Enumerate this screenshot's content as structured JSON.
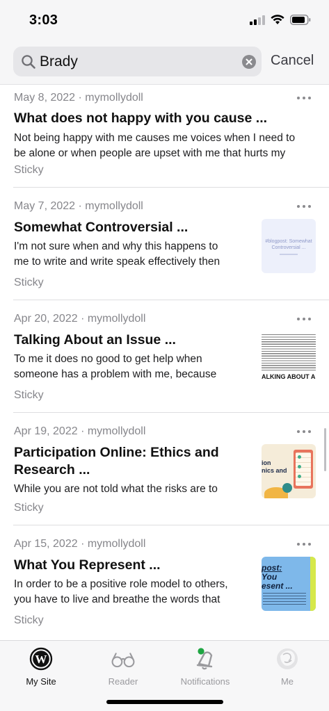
{
  "status_bar": {
    "time": "3:03"
  },
  "search": {
    "query": "Brady",
    "cancel_label": "Cancel"
  },
  "posts": [
    {
      "date_author": "May 8, 2022 · mymollydoll",
      "title": "What does not happy with you cause ...",
      "excerpt_lines": [
        "Not being happy with me causes me voices when I need to",
        "be alone or when people are upset with me that hurts my"
      ],
      "tag": "Sticky",
      "thumbnail": null
    },
    {
      "date_author": "May 7, 2022 · mymollydoll",
      "title": "Somewhat Controversial ...",
      "excerpt_lines": [
        "I'm not sure when and why this happens to",
        "me to write and write speak effectively then"
      ],
      "tag": "Sticky",
      "thumbnail": {
        "icon": "blogpost-thumbnail",
        "text_lines": [
          "#blogpost: Somewhat",
          "Controversial ..."
        ]
      }
    },
    {
      "date_author": "Apr 20, 2022 · mymollydoll",
      "title": "Talking About an Issue ...",
      "excerpt_lines": [
        "To me it does no good to get help when",
        "someone has a problem with me, because"
      ],
      "tag": "Sticky",
      "thumbnail": {
        "icon": "text-page-thumbnail",
        "text_lines": [
          "ALKING ABOUT AN"
        ]
      }
    },
    {
      "date_author": "Apr 19, 2022 · mymollydoll",
      "title_lines": [
        "Participation Online: Ethics and",
        "Research ..."
      ],
      "excerpt_lines": [
        "While you are not told what the risks are to"
      ],
      "tag": "Sticky",
      "thumbnail": {
        "icon": "notebook-illustration-thumbnail",
        "text_lines": [
          "ion",
          "nics and"
        ]
      }
    },
    {
      "date_author": "Apr 15, 2022 · mymollydoll",
      "title": "What You Represent ...",
      "excerpt_lines": [
        "In order to be a positive role model to others,",
        "you have to live and breathe the words that"
      ],
      "tag": "Sticky",
      "thumbnail": {
        "icon": "blue-poster-thumbnail",
        "text_lines": [
          "post:",
          "You",
          "esent ..."
        ]
      }
    }
  ],
  "tabbar": {
    "tabs": [
      {
        "label": "My Site",
        "icon": "wordpress-icon",
        "active": true
      },
      {
        "label": "Reader",
        "icon": "glasses-icon",
        "active": false
      },
      {
        "label": "Notifications",
        "icon": "bell-icon",
        "active": false,
        "badge_color": "#1ea542"
      },
      {
        "label": "Me",
        "icon": "avatar-icon",
        "active": false
      }
    ]
  },
  "colors": {
    "accent_dot": "#1ea542",
    "muted_text": "#86868b"
  }
}
